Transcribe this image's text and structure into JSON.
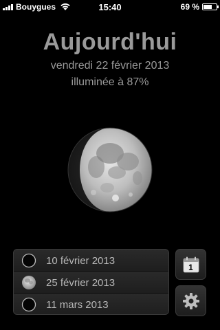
{
  "status_bar": {
    "carrier": "Bouygues",
    "time": "15:40",
    "battery_text": "69 %",
    "battery_level": 0.69,
    "signal_icon": "signal-bars-icon",
    "wifi_icon": "wifi-icon",
    "battery_icon": "battery-icon"
  },
  "header": {
    "title": "Aujourd'hui",
    "date": "vendredi 22 février 2013",
    "illumination": "illuminée à 87%"
  },
  "moon": {
    "icon": "moon-waxing-gibbous-icon",
    "illumination_fraction": 0.87
  },
  "phases": [
    {
      "label": "10 février 2013",
      "icon": "new-moon-icon"
    },
    {
      "label": "25 février 2013",
      "icon": "full-moon-icon"
    },
    {
      "label": "11 mars 2013",
      "icon": "new-moon-icon"
    }
  ],
  "buttons": {
    "calendar_icon": "calendar-icon",
    "calendar_day": "1",
    "settings_icon": "gear-icon"
  },
  "colors": {
    "background": "#000000",
    "header_text": "#9a9a9a",
    "list_text": "#b8b8b8"
  }
}
